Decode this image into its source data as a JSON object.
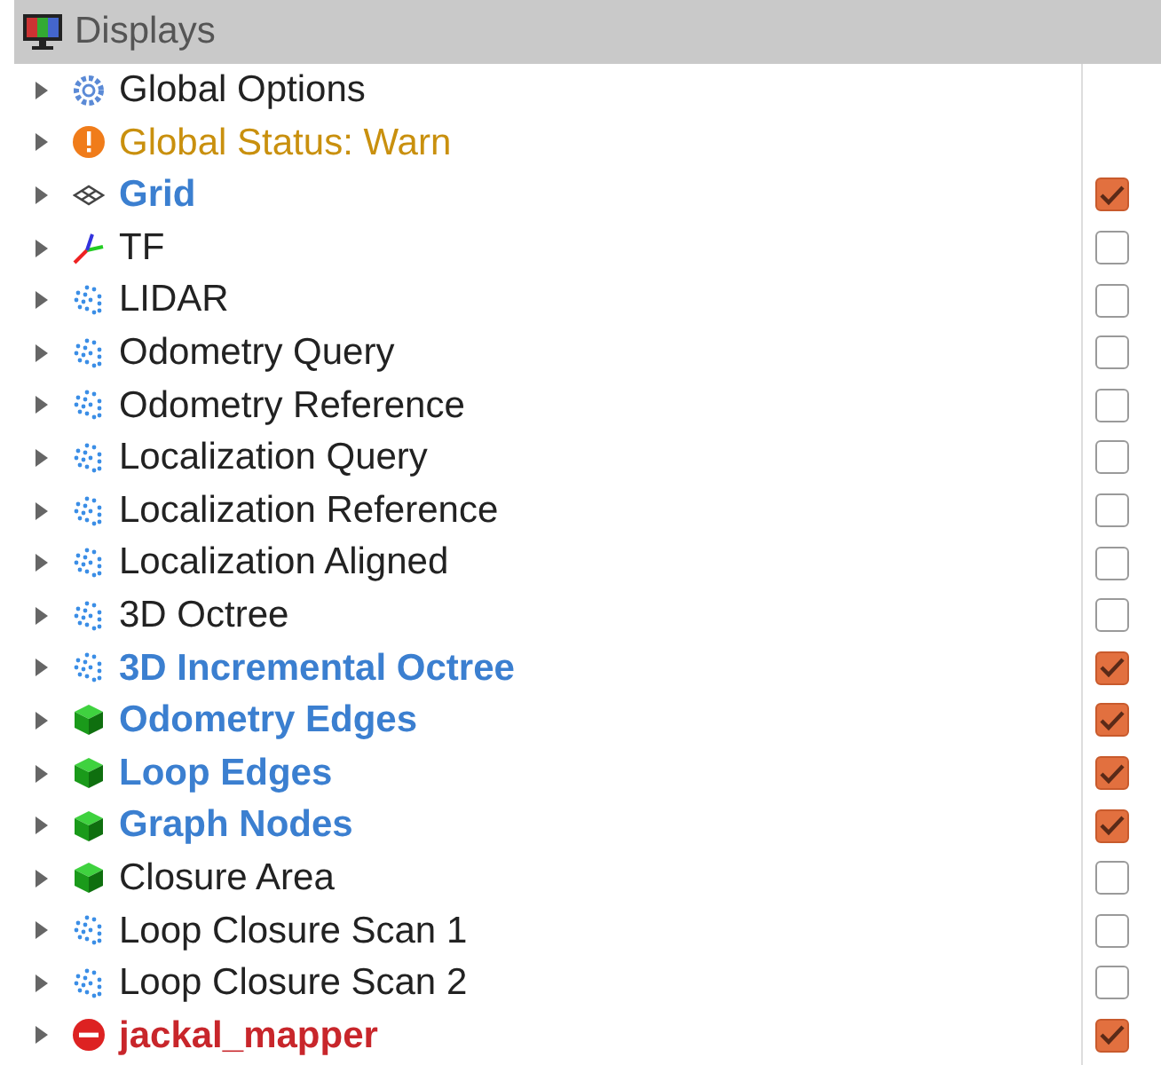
{
  "panel": {
    "title": "Displays"
  },
  "items": [
    {
      "label": "Global Options",
      "kind": "options",
      "expanded": false
    },
    {
      "label": "Global Status: Warn",
      "kind": "warning",
      "expanded": false
    },
    {
      "label": "Grid",
      "kind": "grid",
      "expanded": false,
      "checked": true
    },
    {
      "label": "TF",
      "kind": "axes",
      "expanded": false,
      "checked": false
    },
    {
      "label": "LIDAR",
      "kind": "cloud",
      "expanded": false,
      "checked": false
    },
    {
      "label": "Odometry Query",
      "kind": "cloud",
      "expanded": false,
      "checked": false
    },
    {
      "label": "Odometry Reference",
      "kind": "cloud",
      "expanded": false,
      "checked": false
    },
    {
      "label": "Localization Query",
      "kind": "cloud",
      "expanded": false,
      "checked": false
    },
    {
      "label": "Localization Reference",
      "kind": "cloud",
      "expanded": false,
      "checked": false
    },
    {
      "label": "Localization Aligned",
      "kind": "cloud",
      "expanded": false,
      "checked": false
    },
    {
      "label": "3D Octree",
      "kind": "cloud",
      "expanded": false,
      "checked": false
    },
    {
      "label": "3D Incremental Octree",
      "kind": "cloud",
      "expanded": false,
      "checked": true
    },
    {
      "label": "Odometry Edges",
      "kind": "marker",
      "expanded": false,
      "checked": true
    },
    {
      "label": "Loop Edges",
      "kind": "marker",
      "expanded": false,
      "checked": true
    },
    {
      "label": "Graph Nodes",
      "kind": "marker",
      "expanded": false,
      "checked": true
    },
    {
      "label": "Closure Area",
      "kind": "marker",
      "expanded": false,
      "checked": false
    },
    {
      "label": "Loop Closure Scan 1",
      "kind": "cloud",
      "expanded": false,
      "checked": false
    },
    {
      "label": "Loop Closure Scan 2",
      "kind": "cloud",
      "expanded": false,
      "checked": false
    },
    {
      "label": "jackal_mapper",
      "kind": "error",
      "expanded": false,
      "checked": true
    }
  ]
}
